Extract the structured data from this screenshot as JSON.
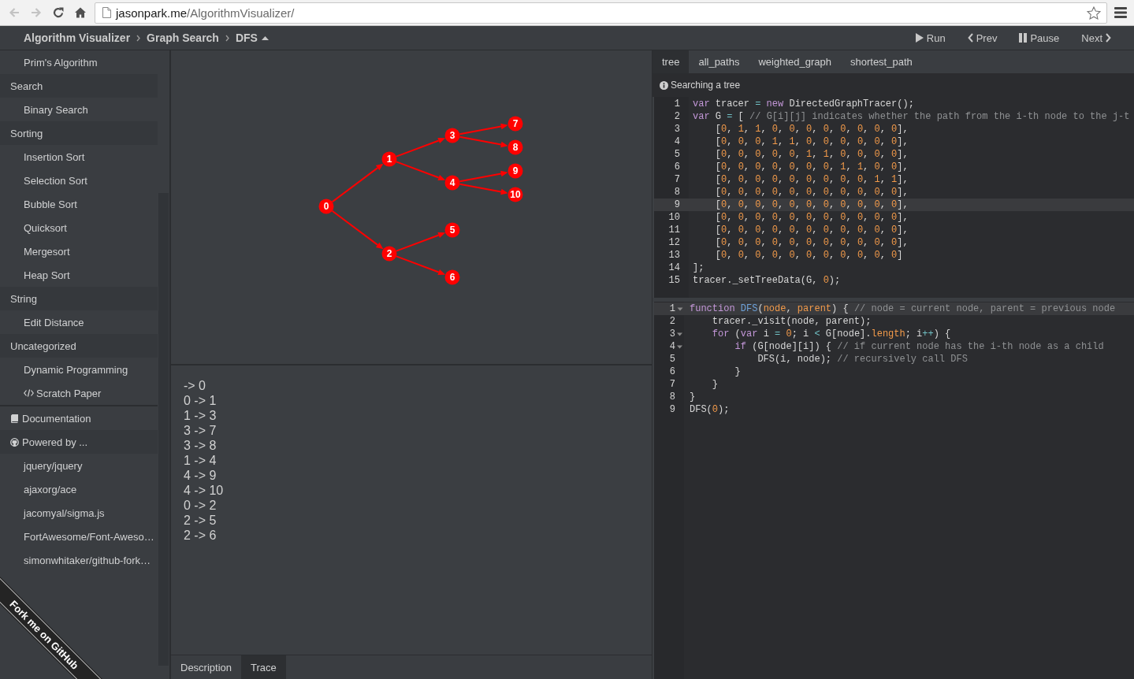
{
  "browser": {
    "nav_buttons": [
      {
        "kind": "back",
        "disabled": true
      },
      {
        "kind": "forward",
        "disabled": true
      },
      {
        "kind": "reload",
        "disabled": false
      },
      {
        "kind": "home",
        "disabled": false
      }
    ],
    "address": {
      "host": "jasonpark.me",
      "path": "/AlgorithmVisualizer/"
    }
  },
  "header": {
    "breadcrumb": [
      {
        "label": "Algorithm Visualizer",
        "dropdown": false
      },
      {
        "label": "Graph Search",
        "dropdown": false
      },
      {
        "label": "DFS",
        "dropdown": true
      }
    ],
    "controls": [
      {
        "kind": "run",
        "label": "Run"
      },
      {
        "kind": "prev",
        "label": "Prev"
      },
      {
        "kind": "pause",
        "label": "Pause"
      },
      {
        "kind": "next",
        "label": "Next"
      }
    ]
  },
  "sidebar": {
    "menu": [
      {
        "kind": "item",
        "label": "Prim's Algorithm"
      },
      {
        "kind": "category",
        "label": "Search",
        "children": [
          {
            "kind": "item",
            "label": "Binary Search"
          }
        ]
      },
      {
        "kind": "category",
        "label": "Sorting",
        "children": [
          {
            "kind": "item",
            "label": "Insertion Sort"
          },
          {
            "kind": "item",
            "label": "Selection Sort"
          },
          {
            "kind": "item",
            "label": "Bubble Sort"
          },
          {
            "kind": "item",
            "label": "Quicksort"
          },
          {
            "kind": "item",
            "label": "Mergesort"
          },
          {
            "kind": "item",
            "label": "Heap Sort"
          }
        ]
      },
      {
        "kind": "category",
        "label": "String",
        "children": [
          {
            "kind": "item",
            "label": "Edit Distance"
          }
        ]
      },
      {
        "kind": "category",
        "label": "Uncategorized",
        "children": [
          {
            "kind": "item",
            "label": "Dynamic Programming"
          }
        ]
      },
      {
        "kind": "scratch",
        "label": "Scratch Paper"
      }
    ],
    "documentation": {
      "label": "Documentation"
    },
    "powered_by": {
      "label": "Powered by ...",
      "links": [
        "jquery/jquery",
        "ajaxorg/ace",
        "jacomyal/sigma.js",
        "FortAwesome/Font-Aweso…",
        "simonwhitaker/github-fork…"
      ]
    },
    "fork_ribbon": {
      "label": "Fork me on GitHub"
    }
  },
  "visualizer": {
    "graph": {
      "root": {
        "label": "0",
        "visited": true,
        "children": [
          {
            "label": "1",
            "visited": true,
            "children": [
              {
                "label": "3",
                "visited": true,
                "children": [
                  {
                    "label": "7",
                    "visited": true
                  },
                  {
                    "label": "8",
                    "visited": true
                  }
                ]
              },
              {
                "label": "4",
                "visited": true,
                "children": [
                  {
                    "label": "9",
                    "visited": true
                  },
                  {
                    "label": "10",
                    "visited": true
                  }
                ]
              }
            ]
          },
          {
            "label": "2",
            "visited": true,
            "children": [
              {
                "label": "5",
                "visited": true
              },
              {
                "label": "6",
                "visited": true
              }
            ]
          }
        ]
      }
    },
    "trace": [
      "-> 0",
      "0 -> 1",
      "1 -> 3",
      "3 -> 7",
      "3 -> 8",
      "1 -> 4",
      "4 -> 9",
      "4 -> 10",
      "0 -> 2",
      "2 -> 5",
      "2 -> 6"
    ],
    "tabs": [
      {
        "label": "Description",
        "selected": false
      },
      {
        "label": "Trace",
        "selected": true
      }
    ]
  },
  "code_panel": {
    "tabs": [
      {
        "label": "tree",
        "selected": true
      },
      {
        "label": "all_paths",
        "selected": false
      },
      {
        "label": "weighted_graph",
        "selected": false
      },
      {
        "label": "shortest_path",
        "selected": false
      }
    ],
    "description": "Searching a tree",
    "data_editor": {
      "lines": [
        {
          "number": "1",
          "active": false,
          "tokens": [
            {
              "kind": "kw",
              "text": "var"
            },
            {
              "kind": "txt",
              "text": " tracer "
            },
            {
              "kind": "op",
              "text": "="
            },
            {
              "kind": "kw",
              "text": " new"
            },
            {
              "kind": "txt",
              "text": " DirectedGraphTracer();"
            }
          ]
        },
        {
          "number": "2",
          "active": false,
          "tokens": [
            {
              "kind": "kw",
              "text": "var"
            },
            {
              "kind": "txt",
              "text": " G "
            },
            {
              "kind": "op",
              "text": "="
            },
            {
              "kind": "txt",
              "text": " [ "
            },
            {
              "kind": "cmt",
              "text": "// G[i][j] indicates whether the path from the i-th node to the j-t"
            }
          ]
        },
        {
          "number": "3",
          "active": false,
          "tokens": [
            {
              "kind": "txt",
              "text": "    ["
            },
            {
              "kind": "num",
              "text": "0"
            },
            {
              "kind": "txt",
              "text": ", "
            },
            {
              "kind": "num",
              "text": "1"
            },
            {
              "kind": "txt",
              "text": ", "
            },
            {
              "kind": "num",
              "text": "1"
            },
            {
              "kind": "txt",
              "text": ", "
            },
            {
              "kind": "num",
              "text": "0"
            },
            {
              "kind": "txt",
              "text": ", "
            },
            {
              "kind": "num",
              "text": "0"
            },
            {
              "kind": "txt",
              "text": ", "
            },
            {
              "kind": "num",
              "text": "0"
            },
            {
              "kind": "txt",
              "text": ", "
            },
            {
              "kind": "num",
              "text": "0"
            },
            {
              "kind": "txt",
              "text": ", "
            },
            {
              "kind": "num",
              "text": "0"
            },
            {
              "kind": "txt",
              "text": ", "
            },
            {
              "kind": "num",
              "text": "0"
            },
            {
              "kind": "txt",
              "text": ", "
            },
            {
              "kind": "num",
              "text": "0"
            },
            {
              "kind": "txt",
              "text": ", "
            },
            {
              "kind": "num",
              "text": "0"
            },
            {
              "kind": "txt",
              "text": "],"
            }
          ]
        },
        {
          "number": "4",
          "active": false,
          "tokens": [
            {
              "kind": "txt",
              "text": "    ["
            },
            {
              "kind": "num",
              "text": "0"
            },
            {
              "kind": "txt",
              "text": ", "
            },
            {
              "kind": "num",
              "text": "0"
            },
            {
              "kind": "txt",
              "text": ", "
            },
            {
              "kind": "num",
              "text": "0"
            },
            {
              "kind": "txt",
              "text": ", "
            },
            {
              "kind": "num",
              "text": "1"
            },
            {
              "kind": "txt",
              "text": ", "
            },
            {
              "kind": "num",
              "text": "1"
            },
            {
              "kind": "txt",
              "text": ", "
            },
            {
              "kind": "num",
              "text": "0"
            },
            {
              "kind": "txt",
              "text": ", "
            },
            {
              "kind": "num",
              "text": "0"
            },
            {
              "kind": "txt",
              "text": ", "
            },
            {
              "kind": "num",
              "text": "0"
            },
            {
              "kind": "txt",
              "text": ", "
            },
            {
              "kind": "num",
              "text": "0"
            },
            {
              "kind": "txt",
              "text": ", "
            },
            {
              "kind": "num",
              "text": "0"
            },
            {
              "kind": "txt",
              "text": ", "
            },
            {
              "kind": "num",
              "text": "0"
            },
            {
              "kind": "txt",
              "text": "],"
            }
          ]
        },
        {
          "number": "5",
          "active": false,
          "tokens": [
            {
              "kind": "txt",
              "text": "    ["
            },
            {
              "kind": "num",
              "text": "0"
            },
            {
              "kind": "txt",
              "text": ", "
            },
            {
              "kind": "num",
              "text": "0"
            },
            {
              "kind": "txt",
              "text": ", "
            },
            {
              "kind": "num",
              "text": "0"
            },
            {
              "kind": "txt",
              "text": ", "
            },
            {
              "kind": "num",
              "text": "0"
            },
            {
              "kind": "txt",
              "text": ", "
            },
            {
              "kind": "num",
              "text": "0"
            },
            {
              "kind": "txt",
              "text": ", "
            },
            {
              "kind": "num",
              "text": "1"
            },
            {
              "kind": "txt",
              "text": ", "
            },
            {
              "kind": "num",
              "text": "1"
            },
            {
              "kind": "txt",
              "text": ", "
            },
            {
              "kind": "num",
              "text": "0"
            },
            {
              "kind": "txt",
              "text": ", "
            },
            {
              "kind": "num",
              "text": "0"
            },
            {
              "kind": "txt",
              "text": ", "
            },
            {
              "kind": "num",
              "text": "0"
            },
            {
              "kind": "txt",
              "text": ", "
            },
            {
              "kind": "num",
              "text": "0"
            },
            {
              "kind": "txt",
              "text": "],"
            }
          ]
        },
        {
          "number": "6",
          "active": false,
          "tokens": [
            {
              "kind": "txt",
              "text": "    ["
            },
            {
              "kind": "num",
              "text": "0"
            },
            {
              "kind": "txt",
              "text": ", "
            },
            {
              "kind": "num",
              "text": "0"
            },
            {
              "kind": "txt",
              "text": ", "
            },
            {
              "kind": "num",
              "text": "0"
            },
            {
              "kind": "txt",
              "text": ", "
            },
            {
              "kind": "num",
              "text": "0"
            },
            {
              "kind": "txt",
              "text": ", "
            },
            {
              "kind": "num",
              "text": "0"
            },
            {
              "kind": "txt",
              "text": ", "
            },
            {
              "kind": "num",
              "text": "0"
            },
            {
              "kind": "txt",
              "text": ", "
            },
            {
              "kind": "num",
              "text": "0"
            },
            {
              "kind": "txt",
              "text": ", "
            },
            {
              "kind": "num",
              "text": "1"
            },
            {
              "kind": "txt",
              "text": ", "
            },
            {
              "kind": "num",
              "text": "1"
            },
            {
              "kind": "txt",
              "text": ", "
            },
            {
              "kind": "num",
              "text": "0"
            },
            {
              "kind": "txt",
              "text": ", "
            },
            {
              "kind": "num",
              "text": "0"
            },
            {
              "kind": "txt",
              "text": "],"
            }
          ]
        },
        {
          "number": "7",
          "active": false,
          "tokens": [
            {
              "kind": "txt",
              "text": "    ["
            },
            {
              "kind": "num",
              "text": "0"
            },
            {
              "kind": "txt",
              "text": ", "
            },
            {
              "kind": "num",
              "text": "0"
            },
            {
              "kind": "txt",
              "text": ", "
            },
            {
              "kind": "num",
              "text": "0"
            },
            {
              "kind": "txt",
              "text": ", "
            },
            {
              "kind": "num",
              "text": "0"
            },
            {
              "kind": "txt",
              "text": ", "
            },
            {
              "kind": "num",
              "text": "0"
            },
            {
              "kind": "txt",
              "text": ", "
            },
            {
              "kind": "num",
              "text": "0"
            },
            {
              "kind": "txt",
              "text": ", "
            },
            {
              "kind": "num",
              "text": "0"
            },
            {
              "kind": "txt",
              "text": ", "
            },
            {
              "kind": "num",
              "text": "0"
            },
            {
              "kind": "txt",
              "text": ", "
            },
            {
              "kind": "num",
              "text": "0"
            },
            {
              "kind": "txt",
              "text": ", "
            },
            {
              "kind": "num",
              "text": "1"
            },
            {
              "kind": "txt",
              "text": ", "
            },
            {
              "kind": "num",
              "text": "1"
            },
            {
              "kind": "txt",
              "text": "],"
            }
          ]
        },
        {
          "number": "8",
          "active": false,
          "tokens": [
            {
              "kind": "txt",
              "text": "    ["
            },
            {
              "kind": "num",
              "text": "0"
            },
            {
              "kind": "txt",
              "text": ", "
            },
            {
              "kind": "num",
              "text": "0"
            },
            {
              "kind": "txt",
              "text": ", "
            },
            {
              "kind": "num",
              "text": "0"
            },
            {
              "kind": "txt",
              "text": ", "
            },
            {
              "kind": "num",
              "text": "0"
            },
            {
              "kind": "txt",
              "text": ", "
            },
            {
              "kind": "num",
              "text": "0"
            },
            {
              "kind": "txt",
              "text": ", "
            },
            {
              "kind": "num",
              "text": "0"
            },
            {
              "kind": "txt",
              "text": ", "
            },
            {
              "kind": "num",
              "text": "0"
            },
            {
              "kind": "txt",
              "text": ", "
            },
            {
              "kind": "num",
              "text": "0"
            },
            {
              "kind": "txt",
              "text": ", "
            },
            {
              "kind": "num",
              "text": "0"
            },
            {
              "kind": "txt",
              "text": ", "
            },
            {
              "kind": "num",
              "text": "0"
            },
            {
              "kind": "txt",
              "text": ", "
            },
            {
              "kind": "num",
              "text": "0"
            },
            {
              "kind": "txt",
              "text": "],"
            }
          ]
        },
        {
          "number": "9",
          "active": true,
          "tokens": [
            {
              "kind": "txt",
              "text": "    ["
            },
            {
              "kind": "num",
              "text": "0"
            },
            {
              "kind": "txt",
              "text": ", "
            },
            {
              "kind": "num",
              "text": "0"
            },
            {
              "kind": "txt",
              "text": ", "
            },
            {
              "kind": "num",
              "text": "0"
            },
            {
              "kind": "txt",
              "text": ", "
            },
            {
              "kind": "num",
              "text": "0"
            },
            {
              "kind": "txt",
              "text": ", "
            },
            {
              "kind": "num",
              "text": "0"
            },
            {
              "kind": "txt",
              "text": ", "
            },
            {
              "kind": "num",
              "text": "0"
            },
            {
              "kind": "txt",
              "text": ", "
            },
            {
              "kind": "num",
              "text": "0"
            },
            {
              "kind": "txt",
              "text": ", "
            },
            {
              "kind": "num",
              "text": "0"
            },
            {
              "kind": "txt",
              "text": ", "
            },
            {
              "kind": "num",
              "text": "0"
            },
            {
              "kind": "txt",
              "text": ", "
            },
            {
              "kind": "num",
              "text": "0"
            },
            {
              "kind": "txt",
              "text": ", "
            },
            {
              "kind": "num",
              "text": "0"
            },
            {
              "kind": "txt",
              "text": "],"
            }
          ]
        },
        {
          "number": "10",
          "active": false,
          "tokens": [
            {
              "kind": "txt",
              "text": "    ["
            },
            {
              "kind": "num",
              "text": "0"
            },
            {
              "kind": "txt",
              "text": ", "
            },
            {
              "kind": "num",
              "text": "0"
            },
            {
              "kind": "txt",
              "text": ", "
            },
            {
              "kind": "num",
              "text": "0"
            },
            {
              "kind": "txt",
              "text": ", "
            },
            {
              "kind": "num",
              "text": "0"
            },
            {
              "kind": "txt",
              "text": ", "
            },
            {
              "kind": "num",
              "text": "0"
            },
            {
              "kind": "txt",
              "text": ", "
            },
            {
              "kind": "num",
              "text": "0"
            },
            {
              "kind": "txt",
              "text": ", "
            },
            {
              "kind": "num",
              "text": "0"
            },
            {
              "kind": "txt",
              "text": ", "
            },
            {
              "kind": "num",
              "text": "0"
            },
            {
              "kind": "txt",
              "text": ", "
            },
            {
              "kind": "num",
              "text": "0"
            },
            {
              "kind": "txt",
              "text": ", "
            },
            {
              "kind": "num",
              "text": "0"
            },
            {
              "kind": "txt",
              "text": ", "
            },
            {
              "kind": "num",
              "text": "0"
            },
            {
              "kind": "txt",
              "text": "],"
            }
          ]
        },
        {
          "number": "11",
          "active": false,
          "tokens": [
            {
              "kind": "txt",
              "text": "    ["
            },
            {
              "kind": "num",
              "text": "0"
            },
            {
              "kind": "txt",
              "text": ", "
            },
            {
              "kind": "num",
              "text": "0"
            },
            {
              "kind": "txt",
              "text": ", "
            },
            {
              "kind": "num",
              "text": "0"
            },
            {
              "kind": "txt",
              "text": ", "
            },
            {
              "kind": "num",
              "text": "0"
            },
            {
              "kind": "txt",
              "text": ", "
            },
            {
              "kind": "num",
              "text": "0"
            },
            {
              "kind": "txt",
              "text": ", "
            },
            {
              "kind": "num",
              "text": "0"
            },
            {
              "kind": "txt",
              "text": ", "
            },
            {
              "kind": "num",
              "text": "0"
            },
            {
              "kind": "txt",
              "text": ", "
            },
            {
              "kind": "num",
              "text": "0"
            },
            {
              "kind": "txt",
              "text": ", "
            },
            {
              "kind": "num",
              "text": "0"
            },
            {
              "kind": "txt",
              "text": ", "
            },
            {
              "kind": "num",
              "text": "0"
            },
            {
              "kind": "txt",
              "text": ", "
            },
            {
              "kind": "num",
              "text": "0"
            },
            {
              "kind": "txt",
              "text": "],"
            }
          ]
        },
        {
          "number": "12",
          "active": false,
          "tokens": [
            {
              "kind": "txt",
              "text": "    ["
            },
            {
              "kind": "num",
              "text": "0"
            },
            {
              "kind": "txt",
              "text": ", "
            },
            {
              "kind": "num",
              "text": "0"
            },
            {
              "kind": "txt",
              "text": ", "
            },
            {
              "kind": "num",
              "text": "0"
            },
            {
              "kind": "txt",
              "text": ", "
            },
            {
              "kind": "num",
              "text": "0"
            },
            {
              "kind": "txt",
              "text": ", "
            },
            {
              "kind": "num",
              "text": "0"
            },
            {
              "kind": "txt",
              "text": ", "
            },
            {
              "kind": "num",
              "text": "0"
            },
            {
              "kind": "txt",
              "text": ", "
            },
            {
              "kind": "num",
              "text": "0"
            },
            {
              "kind": "txt",
              "text": ", "
            },
            {
              "kind": "num",
              "text": "0"
            },
            {
              "kind": "txt",
              "text": ", "
            },
            {
              "kind": "num",
              "text": "0"
            },
            {
              "kind": "txt",
              "text": ", "
            },
            {
              "kind": "num",
              "text": "0"
            },
            {
              "kind": "txt",
              "text": ", "
            },
            {
              "kind": "num",
              "text": "0"
            },
            {
              "kind": "txt",
              "text": "],"
            }
          ]
        },
        {
          "number": "13",
          "active": false,
          "tokens": [
            {
              "kind": "txt",
              "text": "    ["
            },
            {
              "kind": "num",
              "text": "0"
            },
            {
              "kind": "txt",
              "text": ", "
            },
            {
              "kind": "num",
              "text": "0"
            },
            {
              "kind": "txt",
              "text": ", "
            },
            {
              "kind": "num",
              "text": "0"
            },
            {
              "kind": "txt",
              "text": ", "
            },
            {
              "kind": "num",
              "text": "0"
            },
            {
              "kind": "txt",
              "text": ", "
            },
            {
              "kind": "num",
              "text": "0"
            },
            {
              "kind": "txt",
              "text": ", "
            },
            {
              "kind": "num",
              "text": "0"
            },
            {
              "kind": "txt",
              "text": ", "
            },
            {
              "kind": "num",
              "text": "0"
            },
            {
              "kind": "txt",
              "text": ", "
            },
            {
              "kind": "num",
              "text": "0"
            },
            {
              "kind": "txt",
              "text": ", "
            },
            {
              "kind": "num",
              "text": "0"
            },
            {
              "kind": "txt",
              "text": ", "
            },
            {
              "kind": "num",
              "text": "0"
            },
            {
              "kind": "txt",
              "text": ", "
            },
            {
              "kind": "num",
              "text": "0"
            },
            {
              "kind": "txt",
              "text": "]"
            }
          ]
        },
        {
          "number": "14",
          "active": false,
          "tokens": [
            {
              "kind": "txt",
              "text": "];"
            }
          ]
        },
        {
          "number": "15",
          "active": false,
          "tokens": [
            {
              "kind": "txt",
              "text": "tracer._setTreeData(G, "
            },
            {
              "kind": "num",
              "text": "0"
            },
            {
              "kind": "txt",
              "text": ");"
            }
          ]
        }
      ]
    },
    "algorithm_editor": {
      "lines": [
        {
          "number": "1",
          "active": true,
          "foldable": true,
          "tokens": [
            {
              "kind": "kw",
              "text": "function"
            },
            {
              "kind": "fn",
              "text": " DFS"
            },
            {
              "kind": "txt",
              "text": "("
            },
            {
              "kind": "param",
              "text": "node"
            },
            {
              "kind": "txt",
              "text": ", "
            },
            {
              "kind": "param",
              "text": "parent"
            },
            {
              "kind": "txt",
              "text": ") { "
            },
            {
              "kind": "cmt",
              "text": "// node = current node, parent = previous node"
            }
          ]
        },
        {
          "number": "2",
          "active": false,
          "foldable": false,
          "tokens": [
            {
              "kind": "txt",
              "text": "    tracer._visit(node, parent);"
            }
          ]
        },
        {
          "number": "3",
          "active": false,
          "foldable": true,
          "tokens": [
            {
              "kind": "kw",
              "text": "    for"
            },
            {
              "kind": "txt",
              "text": " ("
            },
            {
              "kind": "kw",
              "text": "var"
            },
            {
              "kind": "txt",
              "text": " i "
            },
            {
              "kind": "op",
              "text": "="
            },
            {
              "kind": "num",
              "text": " 0"
            },
            {
              "kind": "txt",
              "text": "; i "
            },
            {
              "kind": "op",
              "text": "<"
            },
            {
              "kind": "txt",
              "text": " G[node]."
            },
            {
              "kind": "prop",
              "text": "length"
            },
            {
              "kind": "txt",
              "text": "; i"
            },
            {
              "kind": "op",
              "text": "++"
            },
            {
              "kind": "txt",
              "text": ") {"
            }
          ]
        },
        {
          "number": "4",
          "active": false,
          "foldable": true,
          "tokens": [
            {
              "kind": "kw",
              "text": "        if"
            },
            {
              "kind": "txt",
              "text": " (G[node][i]) { "
            },
            {
              "kind": "cmt",
              "text": "// if current node has the i-th node as a child"
            }
          ]
        },
        {
          "number": "5",
          "active": false,
          "foldable": false,
          "tokens": [
            {
              "kind": "txt",
              "text": "            DFS(i, node); "
            },
            {
              "kind": "cmt",
              "text": "// recursively call DFS"
            }
          ]
        },
        {
          "number": "6",
          "active": false,
          "foldable": false,
          "tokens": [
            {
              "kind": "txt",
              "text": "        }"
            }
          ]
        },
        {
          "number": "7",
          "active": false,
          "foldable": false,
          "tokens": [
            {
              "kind": "txt",
              "text": "    }"
            }
          ]
        },
        {
          "number": "8",
          "active": false,
          "foldable": false,
          "tokens": [
            {
              "kind": "txt",
              "text": "}"
            }
          ]
        },
        {
          "number": "9",
          "active": false,
          "foldable": false,
          "tokens": [
            {
              "kind": "txt",
              "text": "DFS("
            },
            {
              "kind": "num",
              "text": "0"
            },
            {
              "kind": "txt",
              "text": ");"
            }
          ]
        }
      ]
    }
  }
}
